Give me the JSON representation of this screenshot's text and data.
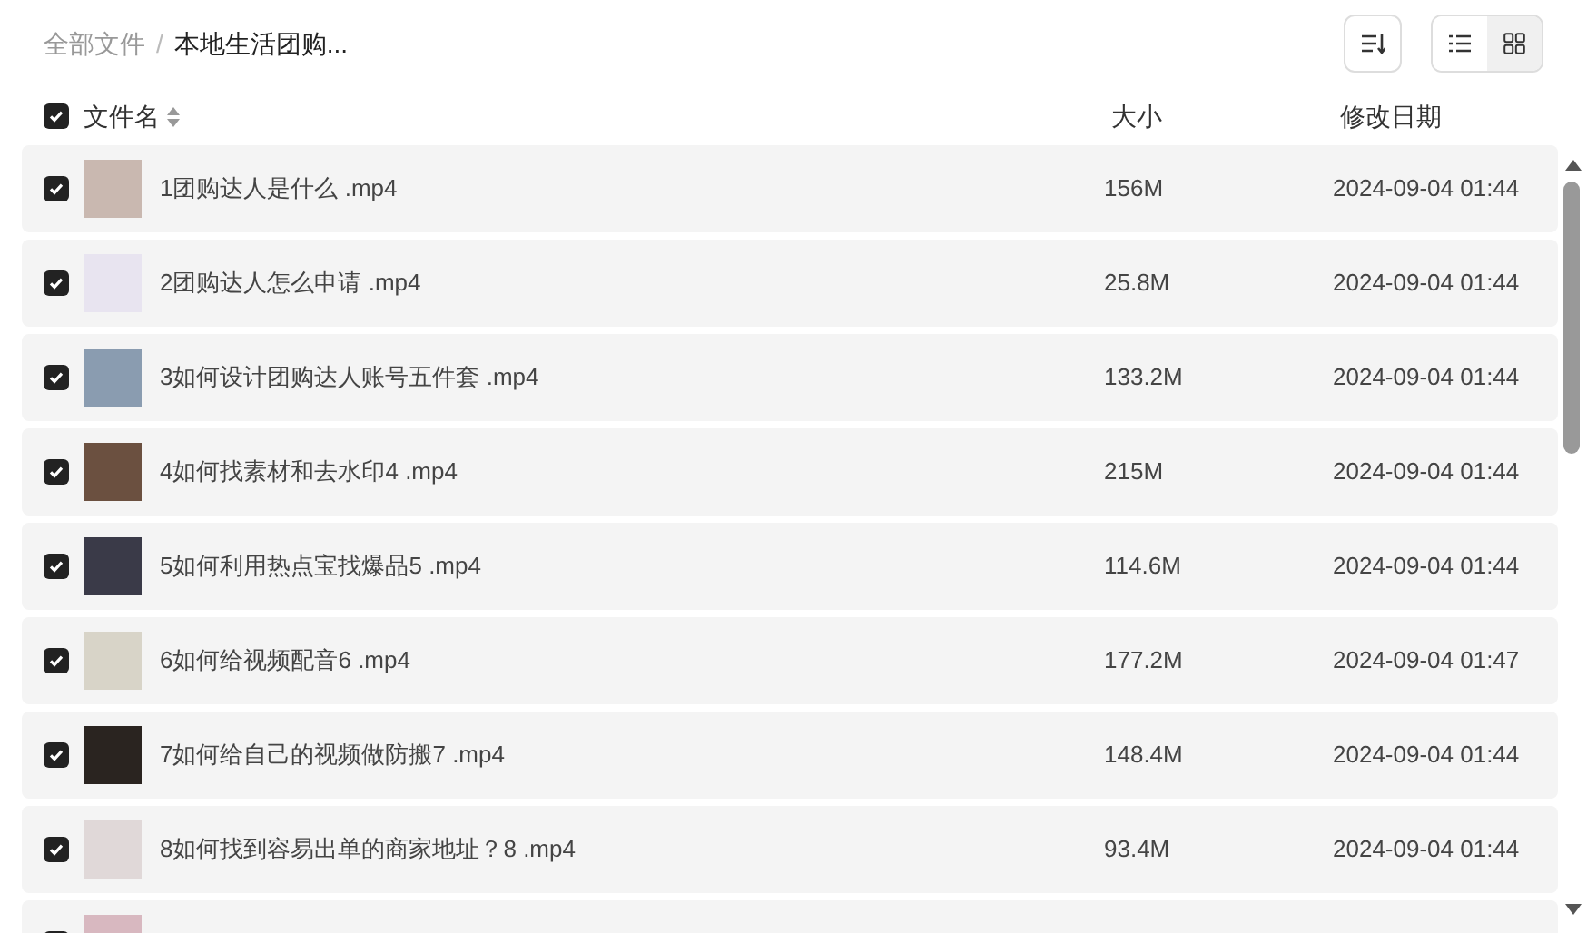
{
  "breadcrumb": [
    {
      "label": "全部文件",
      "current": false
    },
    {
      "label": "本地生活团购...",
      "current": true
    }
  ],
  "breadcrumb_separator": "/",
  "views": [
    {
      "kind": "list",
      "selected": true
    },
    {
      "kind": "grid",
      "selected": false
    }
  ],
  "header": {
    "checked": true,
    "name": "文件名",
    "size": "大小",
    "date": "修改日期"
  },
  "rows": [
    {
      "checked": true,
      "name": "1团购达人是什么 .mp4",
      "size": "156M",
      "date": "2024-09-04 01:44"
    },
    {
      "checked": true,
      "name": "2团购达人怎么申请 .mp4",
      "size": "25.8M",
      "date": "2024-09-04 01:44"
    },
    {
      "checked": true,
      "name": "3如何设计团购达人账号五件套 .mp4",
      "size": "133.2M",
      "date": "2024-09-04 01:44"
    },
    {
      "checked": true,
      "name": "4如何找素材和去水印4 .mp4",
      "size": "215M",
      "date": "2024-09-04 01:44"
    },
    {
      "checked": true,
      "name": "5如何利用热点宝找爆品5 .mp4",
      "size": "114.6M",
      "date": "2024-09-04 01:44"
    },
    {
      "checked": true,
      "name": "6如何给视频配音6 .mp4",
      "size": "177.2M",
      "date": "2024-09-04 01:47"
    },
    {
      "checked": true,
      "name": "7如何给自己的视频做防搬7 .mp4",
      "size": "148.4M",
      "date": "2024-09-04 01:44"
    },
    {
      "checked": true,
      "name": "8如何找到容易出单的商家地址？8 .mp4",
      "size": "93.4M",
      "date": "2024-09-04 01:44"
    },
    {
      "checked": true
    }
  ]
}
